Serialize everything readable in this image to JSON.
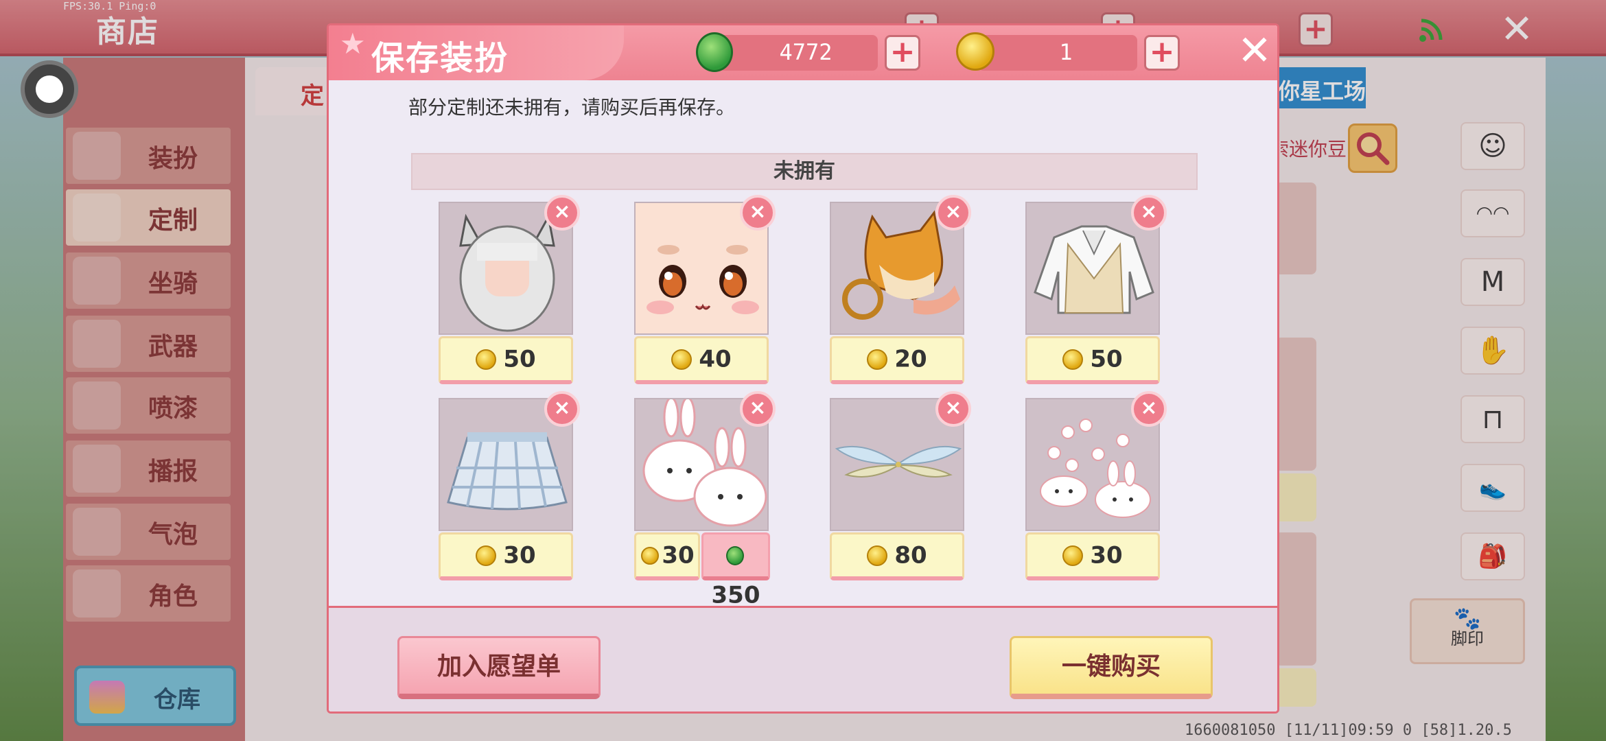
{
  "overlay": {
    "fps": "FPS:30.1  Ping:0"
  },
  "shop": {
    "title": "商店",
    "tab_main": "定",
    "tab_studio": "迷你星工场",
    "search_hint": "搜索迷你豆",
    "sidebar": [
      {
        "label": "装扮",
        "active": false
      },
      {
        "label": "定制",
        "active": true
      },
      {
        "label": "坐骑",
        "active": false
      },
      {
        "label": "武器",
        "active": false
      },
      {
        "label": "喷漆",
        "active": false
      },
      {
        "label": "播报",
        "active": false
      },
      {
        "label": "气泡",
        "active": false
      },
      {
        "label": "角色",
        "active": false
      }
    ],
    "warehouse": "仓库",
    "categories": [
      {
        "icon": "face-icon",
        "glyph": "☺"
      },
      {
        "icon": "mask-icon",
        "glyph": "◠◠"
      },
      {
        "icon": "shirt-icon",
        "glyph": "M"
      },
      {
        "icon": "glove-icon",
        "glyph": "✋"
      },
      {
        "icon": "pants-icon",
        "glyph": "⊓"
      },
      {
        "icon": "shoes-icon",
        "glyph": "👟"
      },
      {
        "icon": "backpack-icon",
        "glyph": "🎒"
      }
    ],
    "footprint_label": "脚印",
    "footer": "1660081050   [11/11]09:59 0    [58]1.20.5"
  },
  "dialog": {
    "title": "保存装扮",
    "currency": {
      "green_gems": "4772",
      "gold_coins": "1"
    },
    "notice": "部分定制还未拥有，请购买后再保存。",
    "section_title": "未拥有",
    "items": [
      {
        "name": "cat-ear-hair",
        "price": "50"
      },
      {
        "name": "cute-face",
        "price": "40"
      },
      {
        "name": "shiba-mask",
        "price": "20"
      },
      {
        "name": "sweater-vest",
        "price": "50"
      },
      {
        "name": "plaid-skirt",
        "price": "30"
      },
      {
        "name": "bunny-slippers",
        "price": "30",
        "alt_price": "350"
      },
      {
        "name": "fairy-wings",
        "price": "80"
      },
      {
        "name": "bunny-footprints",
        "price": "30"
      }
    ],
    "wishlist_button": "加入愿望单",
    "buy_all_button": "一键购买"
  },
  "colors": {
    "accent": "#ee8391",
    "gold": "#e0a810",
    "gem": "#2f9a3a"
  }
}
